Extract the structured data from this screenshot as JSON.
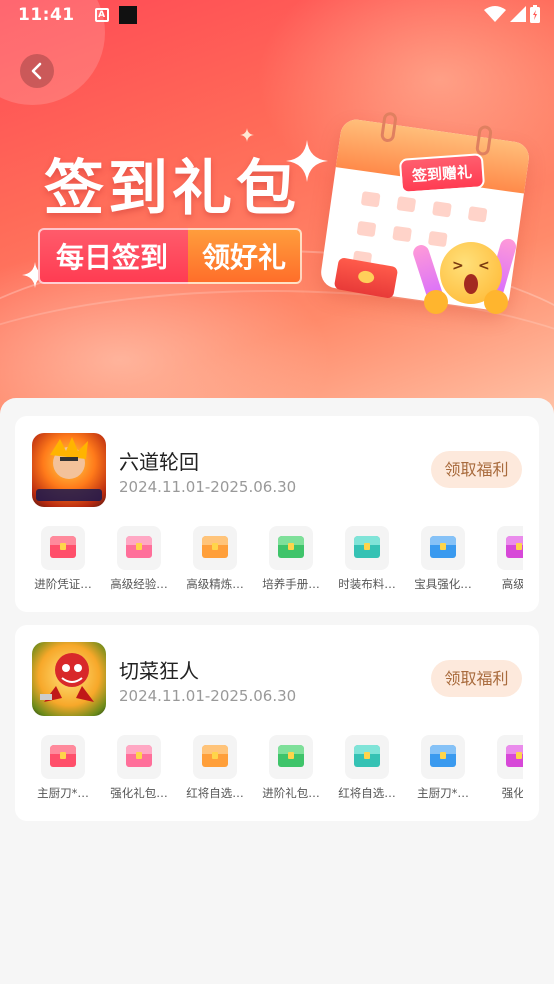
{
  "status": {
    "time": "11:41",
    "a_icon_letter": "A"
  },
  "header": {
    "back_icon": "chevron-left-icon"
  },
  "banner": {
    "title": "签到礼包",
    "pill_left": "每日签到",
    "pill_right": "领好礼",
    "tag": "签到赠礼"
  },
  "games": [
    {
      "name": "六道轮回",
      "date": "2024.11.01-2025.06.30",
      "claim_label": "领取福利",
      "rewards": [
        {
          "label": "进阶凭证…",
          "color": "#ff4f6a"
        },
        {
          "label": "高级经验…",
          "color": "#ff6f9a"
        },
        {
          "label": "高级精炼…",
          "color": "#ff9f3a"
        },
        {
          "label": "培养手册…",
          "color": "#3fc46a"
        },
        {
          "label": "时装布料…",
          "color": "#35c2b4"
        },
        {
          "label": "宝具强化…",
          "color": "#3a9aef"
        },
        {
          "label": "高级培",
          "color": "#d748d8"
        }
      ]
    },
    {
      "name": "切菜狂人",
      "date": "2024.11.01-2025.06.30",
      "claim_label": "领取福利",
      "rewards": [
        {
          "label": "主厨刀*…",
          "color": "#ff4f6a"
        },
        {
          "label": "强化礼包…",
          "color": "#ff6f9a"
        },
        {
          "label": "红将自选…",
          "color": "#ff9f3a"
        },
        {
          "label": "进阶礼包…",
          "color": "#3fc46a"
        },
        {
          "label": "红将自选…",
          "color": "#35c2b4"
        },
        {
          "label": "主厨刀*…",
          "color": "#3a9aef"
        },
        {
          "label": "强化礼",
          "color": "#d748d8"
        }
      ]
    }
  ]
}
